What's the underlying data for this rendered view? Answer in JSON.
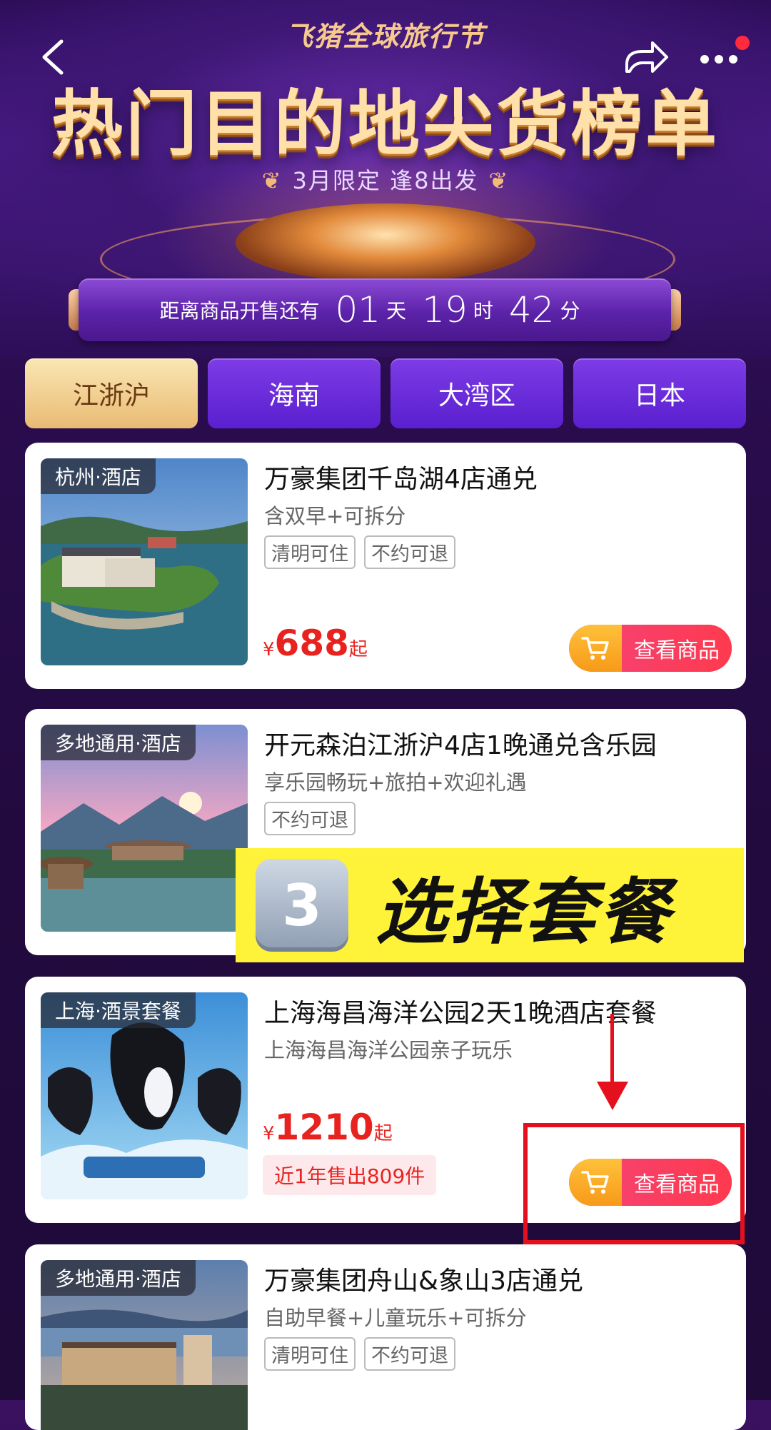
{
  "header": {
    "festival_label": "飞猪全球旅行节",
    "title": "热门目的地尖货榜单",
    "subtitle": "3月限定 逢8出发",
    "countdown": {
      "label": "距离商品开售还有",
      "days": "01",
      "days_unit": "天",
      "hours": "19",
      "hours_unit": "时",
      "minutes": "42",
      "minutes_unit": "分"
    }
  },
  "tabs": [
    {
      "label": "江浙沪",
      "active": true
    },
    {
      "label": "海南",
      "active": false
    },
    {
      "label": "大湾区",
      "active": false
    },
    {
      "label": "日本",
      "active": false
    }
  ],
  "products": [
    {
      "tag": "杭州·酒店",
      "title": "万豪集团千岛湖4店通兑",
      "desc": "含双早+可拆分",
      "badges": [
        "清明可住",
        "不约可退"
      ],
      "currency": "¥",
      "price": "688",
      "price_suffix": "起",
      "button": "查看商品"
    },
    {
      "tag": "多地通用·酒店",
      "title": "开元森泊江浙沪4店1晚通兑含乐园",
      "desc": "享乐园畅玩+旅拍+欢迎礼遇",
      "badges": [
        "不约可退"
      ]
    },
    {
      "tag": "上海·酒景套餐",
      "title": "上海海昌海洋公园2天1晚酒店套餐",
      "desc": "上海海昌海洋公园亲子玩乐",
      "currency": "¥",
      "price": "1210",
      "price_suffix": "起",
      "sold": "近1年售出809件",
      "button": "查看商品"
    },
    {
      "tag": "多地通用·酒店",
      "title": "万豪集团舟山&象山3店通兑",
      "desc": "自助早餐+儿童玩乐+可拆分",
      "badges": [
        "清明可住",
        "不约可退"
      ]
    }
  ],
  "overlay": {
    "step_number": "3",
    "step_text": "选择套餐"
  },
  "colors": {
    "price": "#e8231f",
    "highlight": "#e4101e",
    "step_banner": "#fff33a",
    "tab_active": "#e8bb73",
    "tab_inactive": "#6a2ee0"
  }
}
